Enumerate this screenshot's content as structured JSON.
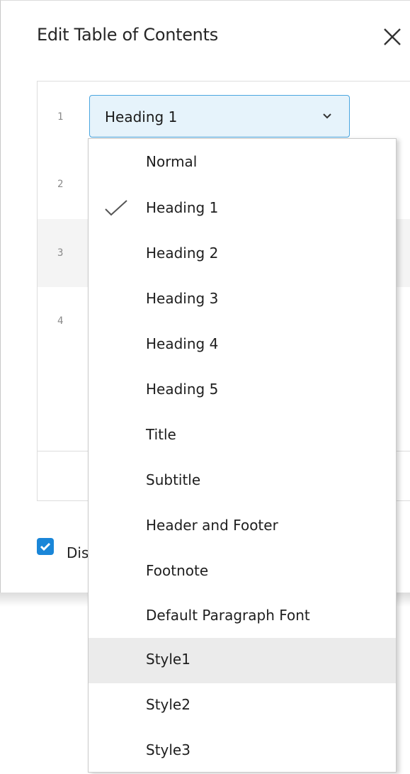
{
  "dialog": {
    "title": "Edit Table of Contents",
    "close_icon": "close-icon"
  },
  "levels": [
    {
      "number": "1",
      "style": "Heading 1"
    },
    {
      "number": "2"
    },
    {
      "number": "3"
    },
    {
      "number": "4"
    }
  ],
  "checkbox": {
    "label": "Dis",
    "checked": true,
    "accent": "#1a86d8"
  },
  "dropdown": {
    "selected": "Heading 1",
    "hovered": "Style1",
    "options": [
      "Normal",
      "Heading 1",
      "Heading 2",
      "Heading 3",
      "Heading 4",
      "Heading 5",
      "Title",
      "Subtitle",
      "Header and Footer",
      "Footnote",
      "Default Paragraph Font",
      "Style1",
      "Style2",
      "Style3"
    ]
  }
}
